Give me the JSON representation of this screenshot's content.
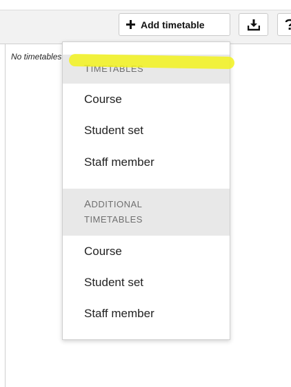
{
  "toolbar": {
    "add_timetable_label": "Add timetable",
    "icons": {
      "add": "plus-icon",
      "download": "download-icon",
      "help": "help-icon"
    }
  },
  "content": {
    "empty_message": "No timetables"
  },
  "dropdown": {
    "sections": [
      {
        "header_lines": [
          "Timetables"
        ],
        "items": [
          "Course",
          "Student set",
          "Staff member"
        ]
      },
      {
        "header_lines": [
          "Additional",
          "timetables"
        ],
        "items": [
          "Course",
          "Student set",
          "Staff member"
        ]
      }
    ]
  },
  "colors": {
    "toolbar_bg": "#f2f2f2",
    "section_header_bg": "#e8e8e8",
    "section_header_text": "#6f6f6f",
    "highlight": "#f2f21d"
  }
}
